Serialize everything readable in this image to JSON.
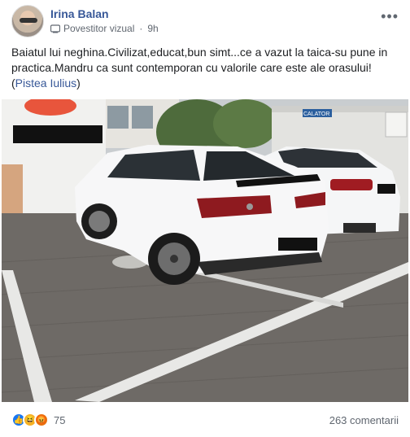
{
  "post": {
    "author": "Irina Balan",
    "badge": "Povestitor vizual",
    "time": "9h",
    "more_icon": "more-horizontal-icon",
    "text_main": "Baiatul lui neghina.Civilizat,educat,bun simt...ce a vazut la taica-su pune in practica.Mandru ca sunt contemporan cu valorile care este ale orasului!(",
    "text_link": "Pistea Iulius",
    "text_end": ")"
  },
  "photo": {
    "sign_text": "CALATOR"
  },
  "footer": {
    "reactions": [
      "like",
      "haha",
      "angry"
    ],
    "reaction_count": "75",
    "comments": "263 comentarii"
  },
  "colors": {
    "link": "#385898",
    "meta": "#606770",
    "like": "#1877f2",
    "haha": "#f7b125",
    "angry": "#e9710f"
  }
}
